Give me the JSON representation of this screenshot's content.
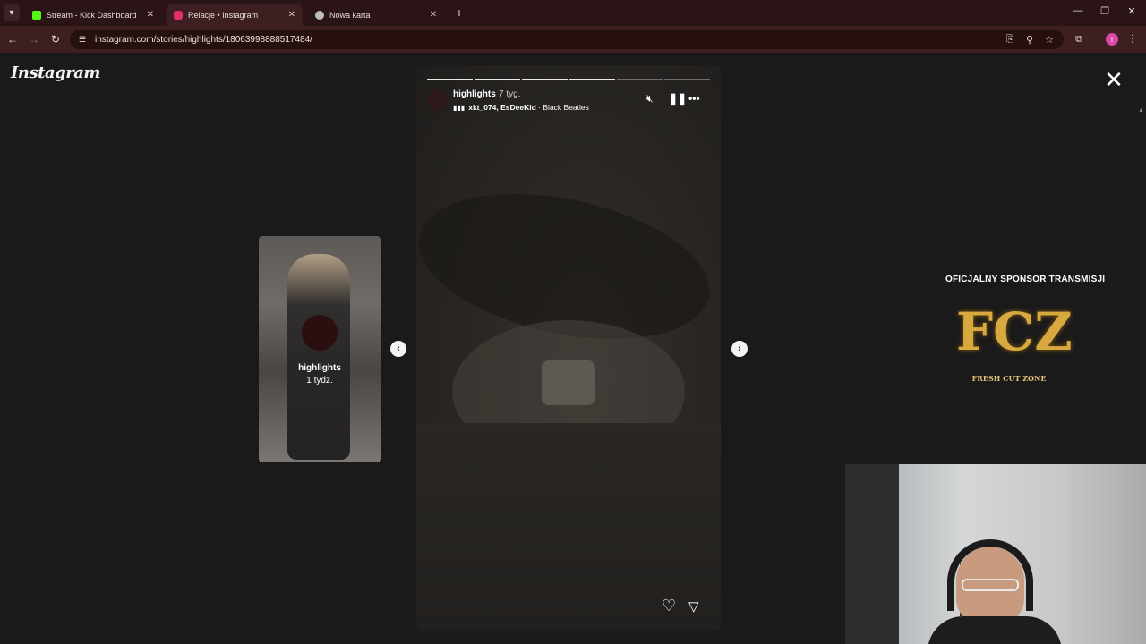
{
  "browser": {
    "tabs": [
      {
        "label": "Stream - Kick Dashboard",
        "favicon_color": "#53fc18",
        "active": false
      },
      {
        "label": "Relacje • Instagram",
        "favicon_color": "#e1306c",
        "active": true
      },
      {
        "label": "Nowa karta",
        "favicon_color": "#bdbdbd",
        "active": false
      }
    ],
    "url": "instagram.com/stories/highlights/18063998888517484/"
  },
  "page": {
    "logo": "Instagram",
    "prev_story": {
      "name": "highlights",
      "time": "1 tydz."
    },
    "story": {
      "username": "highlights",
      "time": "7 tyg.",
      "music_artists": "xkt_074, EsDeeKid",
      "music_title": "Black Beatles",
      "progress_segments": 6,
      "progress_done": 4
    }
  },
  "sponsor": {
    "title": "OFICJALNY SPONSOR TRANSMISJI",
    "logo_text": "FCZ",
    "subtitle": "FRESH CUT ZONE"
  }
}
